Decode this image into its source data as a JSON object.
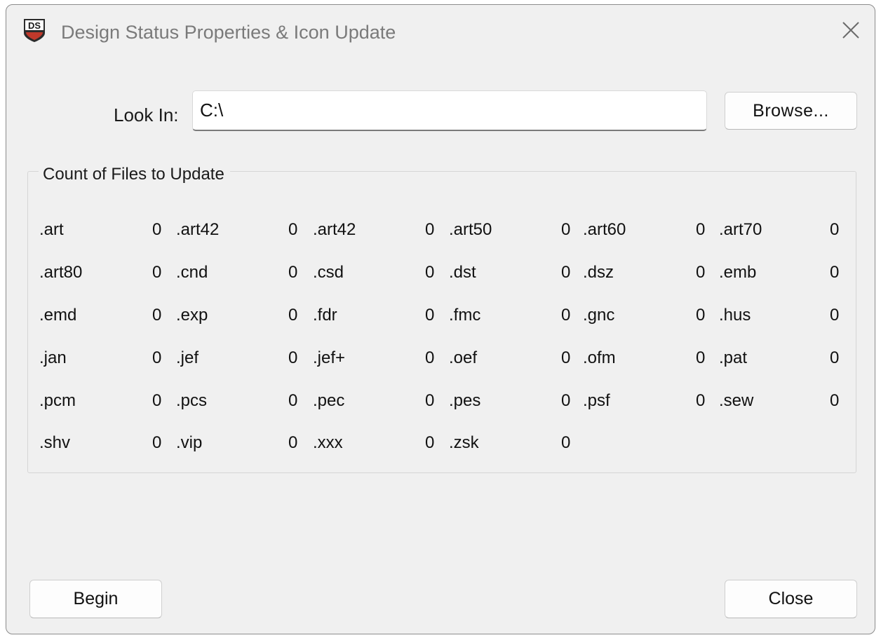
{
  "window": {
    "title": "Design Status Properties & Icon Update",
    "app_icon_text": "DS"
  },
  "look_in": {
    "label": "Look In:",
    "value": "C:\\",
    "browse_label": "Browse..."
  },
  "group": {
    "title": "Count of Files to Update",
    "files": [
      [
        {
          "ext": ".art",
          "count": "0"
        },
        {
          "ext": ".art42",
          "count": "0"
        },
        {
          "ext": ".art42",
          "count": "0"
        },
        {
          "ext": ".art50",
          "count": "0"
        },
        {
          "ext": ".art60",
          "count": "0"
        },
        {
          "ext": ".art70",
          "count": "0"
        }
      ],
      [
        {
          "ext": ".art80",
          "count": "0"
        },
        {
          "ext": ".cnd",
          "count": "0"
        },
        {
          "ext": ".csd",
          "count": "0"
        },
        {
          "ext": ".dst",
          "count": "0"
        },
        {
          "ext": ".dsz",
          "count": "0"
        },
        {
          "ext": ".emb",
          "count": "0"
        }
      ],
      [
        {
          "ext": ".emd",
          "count": "0"
        },
        {
          "ext": ".exp",
          "count": "0"
        },
        {
          "ext": ".fdr",
          "count": "0"
        },
        {
          "ext": ".fmc",
          "count": "0"
        },
        {
          "ext": ".gnc",
          "count": "0"
        },
        {
          "ext": ".hus",
          "count": "0"
        }
      ],
      [
        {
          "ext": ".jan",
          "count": "0"
        },
        {
          "ext": ".jef",
          "count": "0"
        },
        {
          "ext": ".jef+",
          "count": "0"
        },
        {
          "ext": ".oef",
          "count": "0"
        },
        {
          "ext": ".ofm",
          "count": "0"
        },
        {
          "ext": ".pat",
          "count": "0"
        }
      ],
      [
        {
          "ext": ".pcm",
          "count": "0"
        },
        {
          "ext": ".pcs",
          "count": "0"
        },
        {
          "ext": ".pec",
          "count": "0"
        },
        {
          "ext": ".pes",
          "count": "0"
        },
        {
          "ext": ".psf",
          "count": "0"
        },
        {
          "ext": ".sew",
          "count": "0"
        }
      ],
      [
        {
          "ext": ".shv",
          "count": "0"
        },
        {
          "ext": ".vip",
          "count": "0"
        },
        {
          "ext": ".xxx",
          "count": "0"
        },
        {
          "ext": ".zsk",
          "count": "0"
        }
      ]
    ]
  },
  "actions": {
    "begin_label": "Begin",
    "close_label": "Close"
  },
  "icons": {
    "app": "ds-app-icon",
    "close": "close-icon"
  },
  "colors": {
    "window_bg": "#f0f0f0",
    "icon_red": "#c0392b",
    "icon_dark": "#2b2b2b"
  }
}
